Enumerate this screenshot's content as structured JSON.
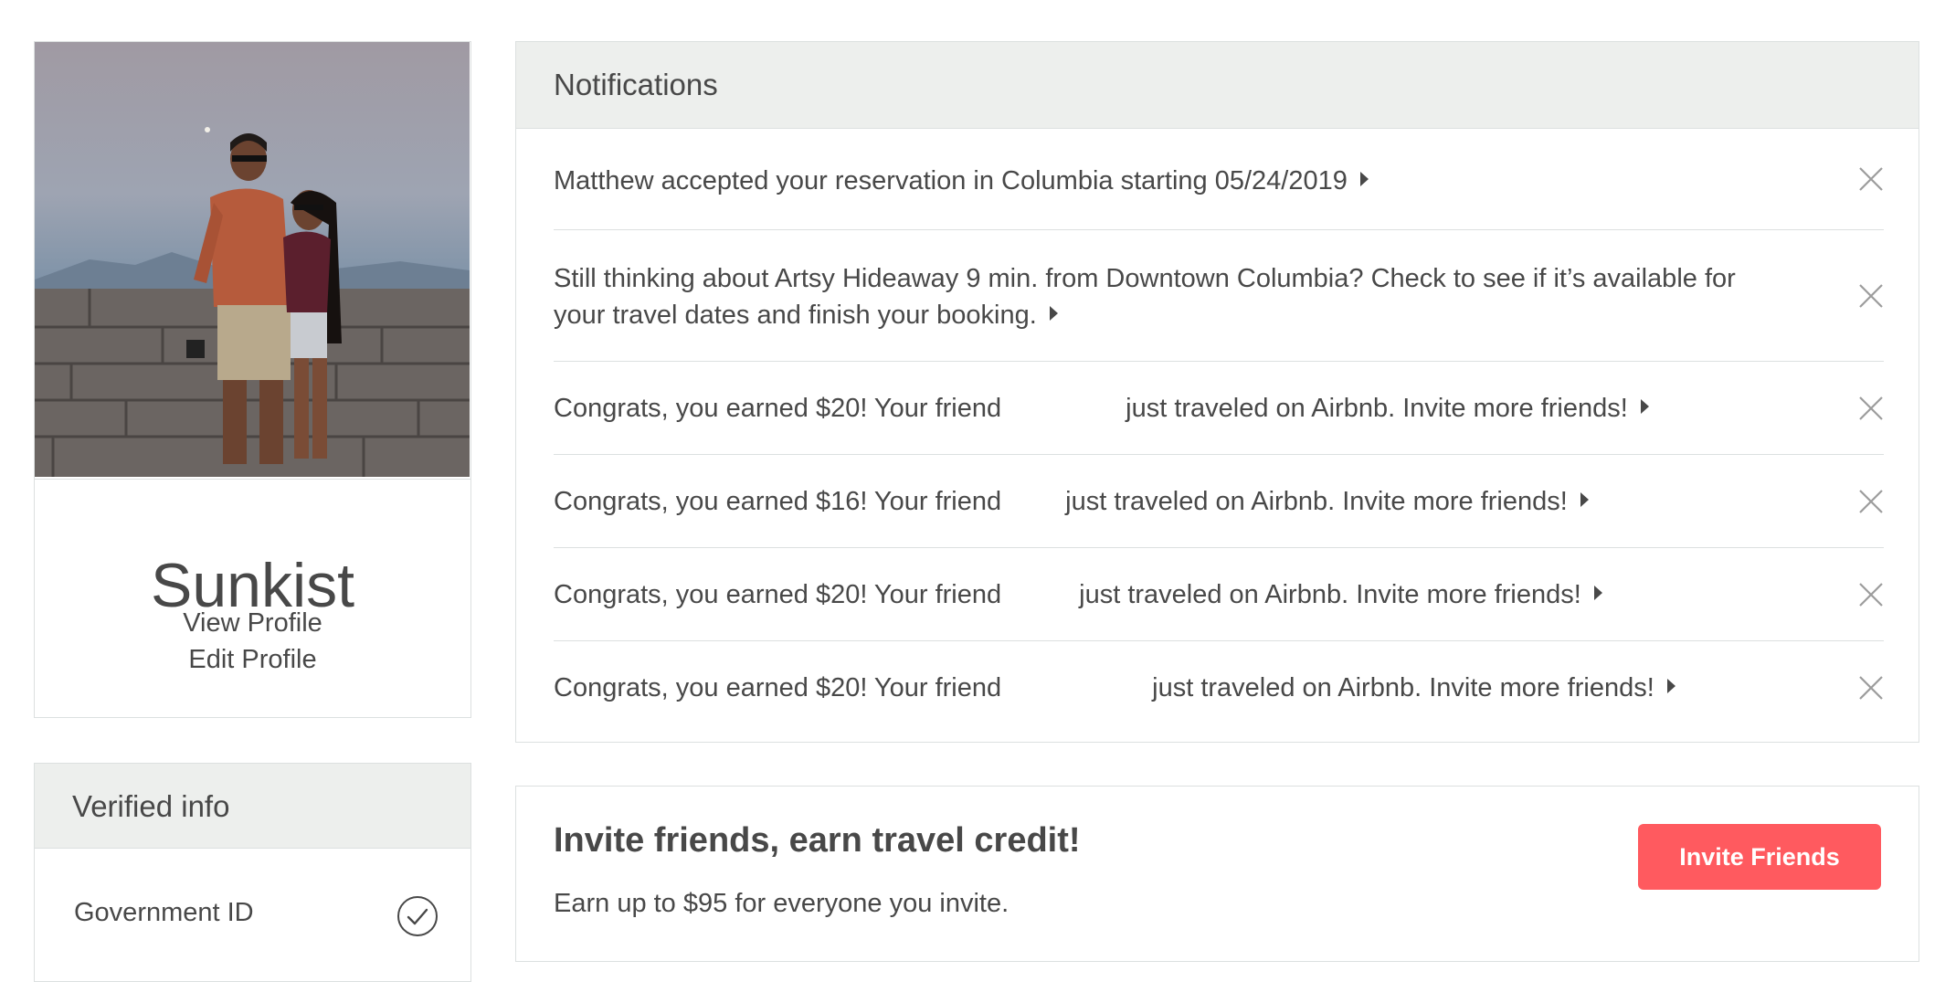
{
  "profile": {
    "name": "Sunkist",
    "view_profile_label": "View Profile",
    "edit_profile_label": "Edit Profile"
  },
  "verified_info": {
    "title": "Verified info",
    "items": [
      {
        "label": "Government ID",
        "icon": "check-circle-icon"
      }
    ]
  },
  "notifications": {
    "title": "Notifications",
    "items": [
      {
        "text": "Matthew accepted your reservation in Columbia starting 05/24/2019"
      },
      {
        "line1": "Still thinking about Artsy Hideaway 9 min. from Downtown Columbia? Check to see if it’s available for",
        "line2": "your travel dates and finish your booking."
      },
      {
        "part1": "Congrats, you earned $20! Your friend",
        "part2": "just traveled on Airbnb. Invite more friends!"
      },
      {
        "part1": "Congrats, you earned $16! Your friend",
        "part2": "just traveled on Airbnb. Invite more friends!"
      },
      {
        "part1": "Congrats, you earned $20! Your friend",
        "part2": "just traveled on Airbnb. Invite more friends!"
      },
      {
        "part1": "Congrats, you earned $20! Your friend",
        "part2": "just traveled on Airbnb. Invite more friends!"
      }
    ]
  },
  "invite": {
    "title": "Invite friends, earn travel credit!",
    "subtitle": "Earn up to $95 for everyone you invite.",
    "button_label": "Invite Friends"
  },
  "colors": {
    "accent": "#ff5a5f",
    "text": "#484848",
    "header_bg": "#edefed",
    "border": "#dce0e0"
  }
}
